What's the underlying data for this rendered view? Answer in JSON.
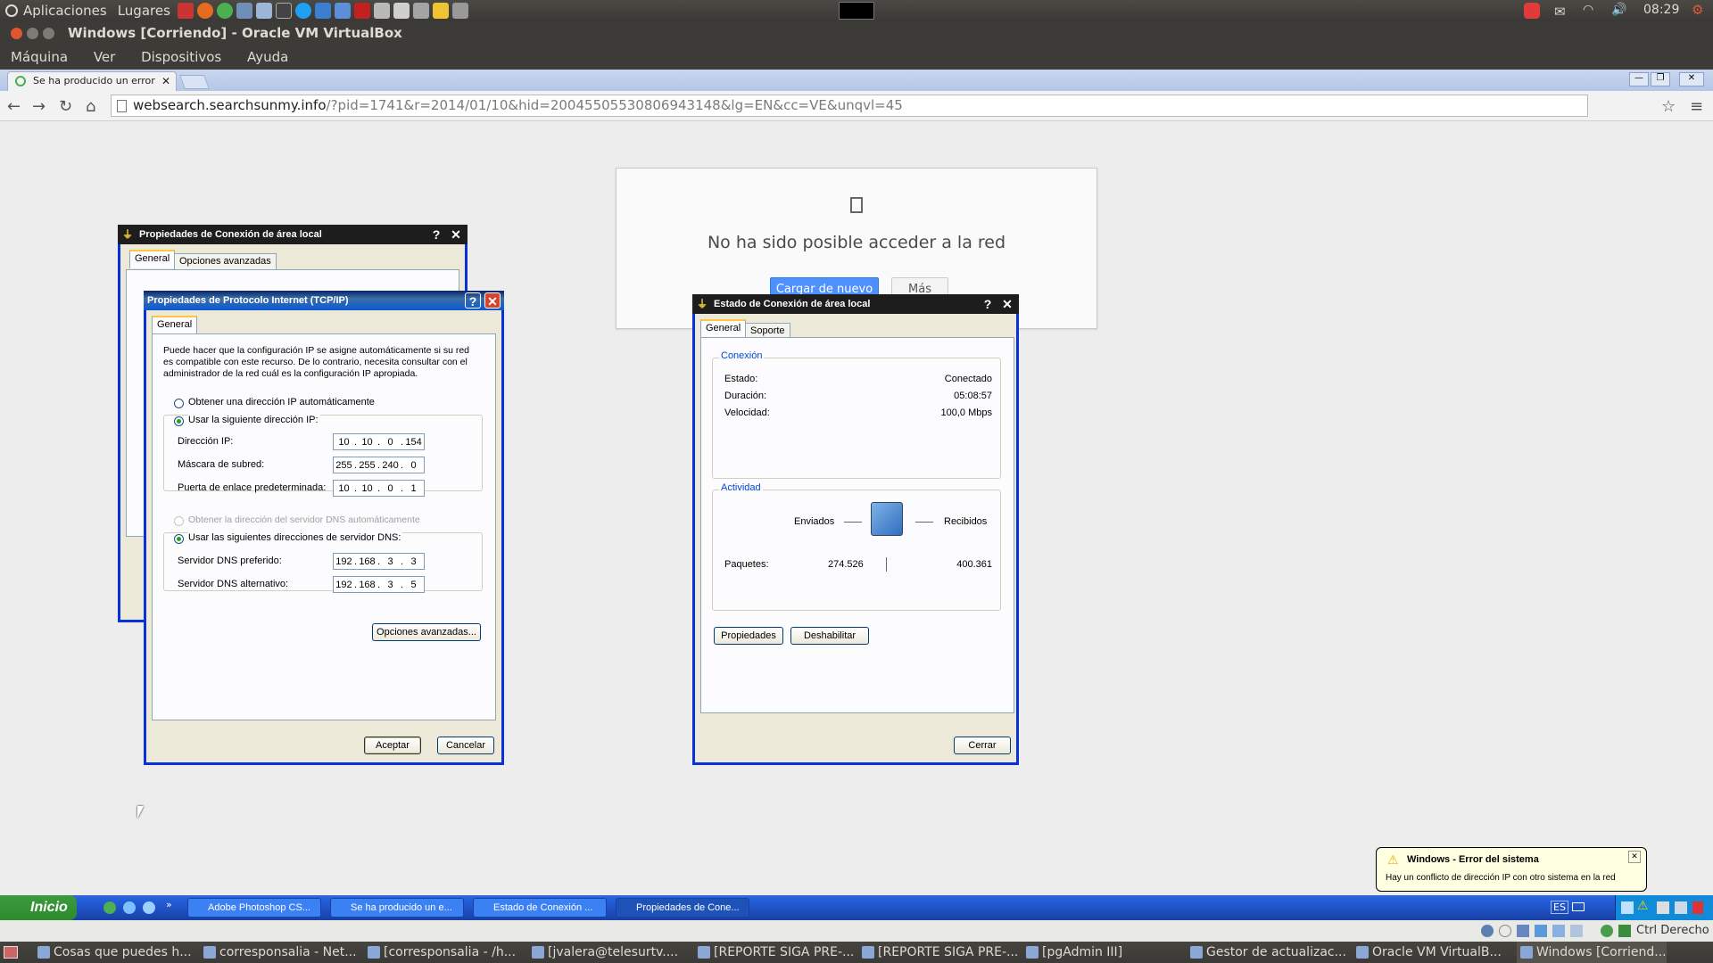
{
  "top_panel": {
    "apps": "Aplicaciones",
    "places": "Lugares",
    "clock": "08:29"
  },
  "vbox": {
    "title": "Windows [Corriendo] - Oracle VM VirtualBox",
    "menu": [
      "Máquina",
      "Ver",
      "Dispositivos",
      "Ayuda"
    ],
    "host_key": "Ctrl Derecho"
  },
  "browser": {
    "tab_title": "Se ha producido un error al c",
    "url_host": "websearch.searchsunmy.info",
    "url_rest": "/?pid=1741&r=2014/01/10&hid=20045505530806943148&lg=EN&cc=VE&unqvl=45",
    "error_title": "No ha sido posible acceder a la red",
    "reload_label": "Cargar de nuevo",
    "more_label": "Más"
  },
  "dlg_lan_props": {
    "title": "Propiedades de Conexión de área local",
    "tabs": [
      "General",
      "Opciones avanzadas"
    ]
  },
  "dlg_tcpip": {
    "title": "Propiedades de Protocolo Internet (TCP/IP)",
    "tab": "General",
    "description": "Puede hacer que la configuración IP se asigne automáticamente si su red es compatible con este recurso. De lo contrario, necesita consultar con el administrador de la red cuál es la configuración IP apropiada.",
    "auto_ip": "Obtener una dirección IP automáticamente",
    "manual_ip": "Usar la siguiente dirección IP:",
    "ip_label": "Dirección IP:",
    "ip": [
      "10",
      "10",
      "0",
      "154"
    ],
    "mask_label": "Máscara de subred:",
    "mask": [
      "255",
      "255",
      "240",
      "0"
    ],
    "gw_label": "Puerta de enlace predeterminada:",
    "gw": [
      "10",
      "10",
      "0",
      "1"
    ],
    "auto_dns": "Obtener la dirección del servidor DNS automáticamente",
    "manual_dns": "Usar las siguientes direcciones de servidor DNS:",
    "dns1_label": "Servidor DNS preferido:",
    "dns1": [
      "192",
      "168",
      "3",
      "3"
    ],
    "dns2_label": "Servidor DNS alternativo:",
    "dns2": [
      "192",
      "168",
      "3",
      "5"
    ],
    "advanced": "Opciones avanzadas...",
    "ok": "Aceptar",
    "cancel": "Cancelar"
  },
  "dlg_status": {
    "title": "Estado de Conexión de área local",
    "tabs": [
      "General",
      "Soporte"
    ],
    "conn_group": "Conexión",
    "state_label": "Estado:",
    "state_value": "Conectado",
    "duration_label": "Duración:",
    "duration_value": "05:08:57",
    "speed_label": "Velocidad:",
    "speed_value": "100,0 Mbps",
    "activity_group": "Actividad",
    "sent_label": "Enviados",
    "received_label": "Recibidos",
    "packets_label": "Paquetes:",
    "packets_sent": "274.526",
    "packets_received": "400.361",
    "properties_btn": "Propiedades",
    "disable_btn": "Deshabilitar",
    "close_btn": "Cerrar"
  },
  "xp_taskbar": {
    "start": "Inicio",
    "items": [
      "Adobe Photoshop CS...",
      "Se ha producido un e...",
      "Estado de Conexión ...",
      "Propiedades de Cone..."
    ],
    "lang": "ES"
  },
  "balloon": {
    "title": "Windows - Error del sistema",
    "text": "Hay un conflicto de dirección IP con otro sistema en la red"
  },
  "bottom_panel": {
    "items": [
      "Cosas que puedes h...",
      "corresponsalia - Net...",
      "[corresponsalia - /h...",
      "[jvalera@telesurtv....",
      "[REPORTE SIGA PRE-...",
      "[REPORTE SIGA PRE-...",
      "[pgAdmin III]",
      "Gestor de actualizac...",
      "Oracle VM VirtualB...",
      "Windows [Corriend..."
    ]
  }
}
